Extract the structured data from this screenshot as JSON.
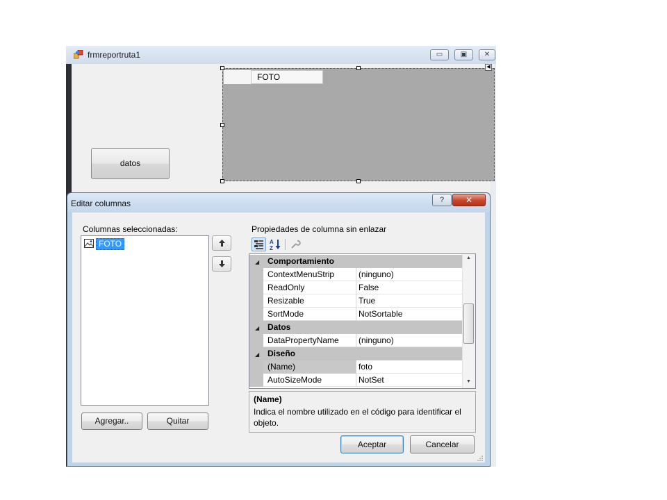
{
  "background_window": {
    "title": "frmreportruta1",
    "button_label": "datos",
    "grid_column_header": "FOTO"
  },
  "dialog": {
    "title": "Editar columnas",
    "help_label": "?",
    "selected_columns_label": "Columnas seleccionadas:",
    "selected_columns": [
      {
        "label": "FOTO",
        "icon": "image-column-icon",
        "selected": true
      }
    ],
    "add_button": "Agregar..",
    "remove_button": "Quitar",
    "ok_button": "Aceptar",
    "cancel_button": "Cancelar",
    "properties_label": "Propiedades de columna sin enlazar",
    "property_grid": [
      {
        "type": "category",
        "name": "Comportamiento"
      },
      {
        "type": "property",
        "name": "ContextMenuStrip",
        "value": "(ninguno)"
      },
      {
        "type": "property",
        "name": "ReadOnly",
        "value": "False"
      },
      {
        "type": "property",
        "name": "Resizable",
        "value": "True"
      },
      {
        "type": "property",
        "name": "SortMode",
        "value": "NotSortable"
      },
      {
        "type": "category",
        "name": "Datos"
      },
      {
        "type": "property",
        "name": "DataPropertyName",
        "value": "(ninguno)"
      },
      {
        "type": "category",
        "name": "Diseño"
      },
      {
        "type": "property",
        "name": "(Name)",
        "value": "foto",
        "selected": true
      },
      {
        "type": "property",
        "name": "AutoSizeMode",
        "value": "NotSet"
      }
    ],
    "description": {
      "title": "(Name)",
      "text": "Indica el nombre utilizado en el código para identificar el objeto."
    }
  }
}
